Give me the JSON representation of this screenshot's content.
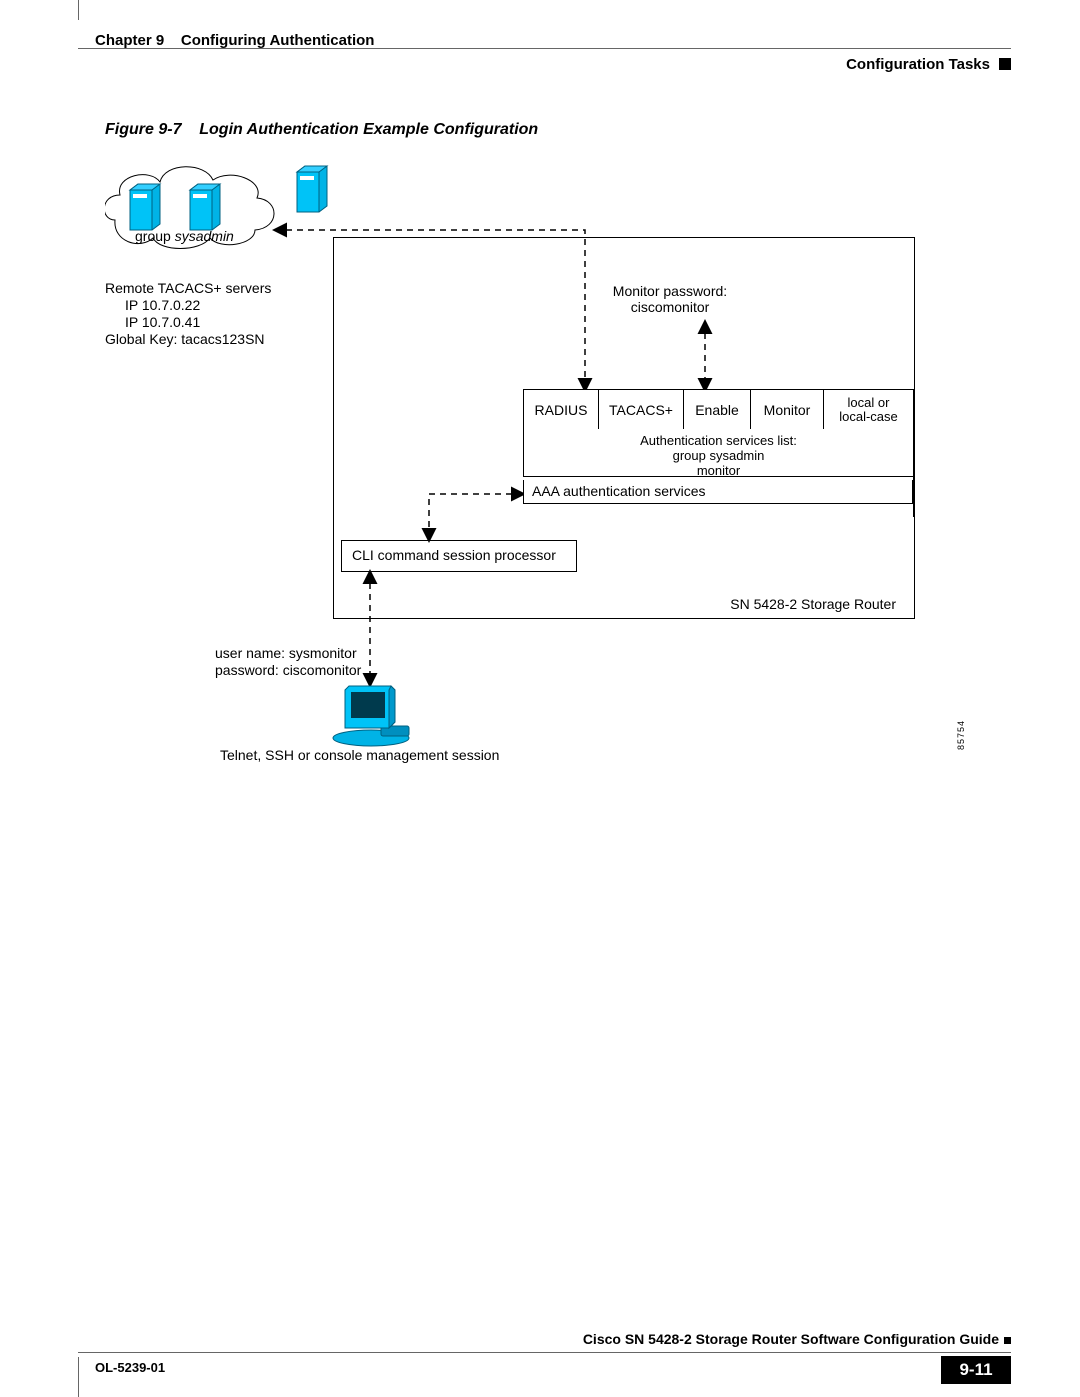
{
  "header": {
    "chapter": "Chapter 9",
    "title": "Configuring Authentication",
    "section": "Configuration Tasks"
  },
  "figure": {
    "caption_prefix": "Figure 9-7",
    "caption_title": "Login Authentication Example Configuration",
    "id": "85754"
  },
  "cloud": {
    "label_plain": "group ",
    "label_italic": "sysadmin"
  },
  "tacacs": {
    "line1": "Remote TACACS+ servers",
    "line2": "IP 10.7.0.22",
    "line3": "IP 10.7.0.41",
    "line4": "Global Key: tacacs123SN"
  },
  "monitor_pwd": {
    "line1": "Monitor password:",
    "line2": "ciscomonitor"
  },
  "services": {
    "c0": "RADIUS",
    "c1": "TACACS+",
    "c2": "Enable",
    "c3": "Monitor",
    "c4": "local or\nlocal-case"
  },
  "auth_list": {
    "l1": "Authentication services list:",
    "l2": "group sysadmin",
    "l3": "monitor"
  },
  "aaa": "AAA authentication services",
  "cli": "CLI command session processor",
  "router": "SN 5428-2 Storage Router",
  "user_pass": {
    "l1": "user name: sysmonitor",
    "l2": "password: ciscomonitor"
  },
  "telnet": "Telnet, SSH or console management session",
  "footer": {
    "title": "Cisco SN 5428-2 Storage Router Software Configuration Guide",
    "partno": "OL-5239-01",
    "page": "9-11"
  }
}
